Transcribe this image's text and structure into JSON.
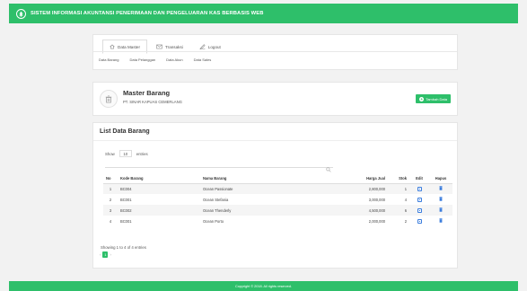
{
  "header": {
    "title": "SISTEM INFORMASI AKUNTANSI PENERIMAAN DAN PENGELUARAN KAS BERBASIS WEB",
    "logo_icon": "tree-logo-icon",
    "background_color": "#2ebf6a"
  },
  "nav": {
    "tabs": [
      {
        "label": "Data Master",
        "icon": "home-icon",
        "active": true
      },
      {
        "label": "Transaksi",
        "icon": "envelope-icon",
        "active": false
      },
      {
        "label": "Logout",
        "icon": "logout-icon",
        "active": false
      }
    ],
    "subnav": [
      "Data Barang",
      "Data Pelanggan",
      "Data Akun",
      "Data Sales"
    ]
  },
  "master": {
    "title": "Master Barang",
    "subtitle": "PT. SINAR KAPUAS CEMERLANG",
    "icon": "trash-icon",
    "add_button_label": "Tambah Data"
  },
  "list": {
    "title": "List Data Barang",
    "show_label": "Show",
    "entries_value": "10",
    "entries_label": "entries",
    "search_icon": "search-icon",
    "columns": [
      "No",
      "Kode Barang",
      "Nama Barang",
      "Harga Jual",
      "Stok",
      "Edit",
      "Hapus"
    ],
    "rows": [
      {
        "no": "1",
        "kode": "BC004",
        "nama": "Ocean Passionate",
        "harga": "2,800,000",
        "stok": "1"
      },
      {
        "no": "2",
        "kode": "BC001",
        "nama": "Ocean Stefania",
        "harga": "3,000,000",
        "stok": "4"
      },
      {
        "no": "3",
        "kode": "BC002",
        "nama": "Ocean Thenderly",
        "harga": "4,500,000",
        "stok": "6"
      },
      {
        "no": "4",
        "kode": "BC001",
        "nama": "Ocean Porto",
        "harga": "2,000,000",
        "stok": "2"
      }
    ],
    "showing_text": "Showing 1 to 4 of 4 entries",
    "pagination": {
      "prev": "‹",
      "current": "1",
      "next": "›"
    }
  },
  "footer": {
    "text": "Copyright © 2018. All rights reserved."
  }
}
